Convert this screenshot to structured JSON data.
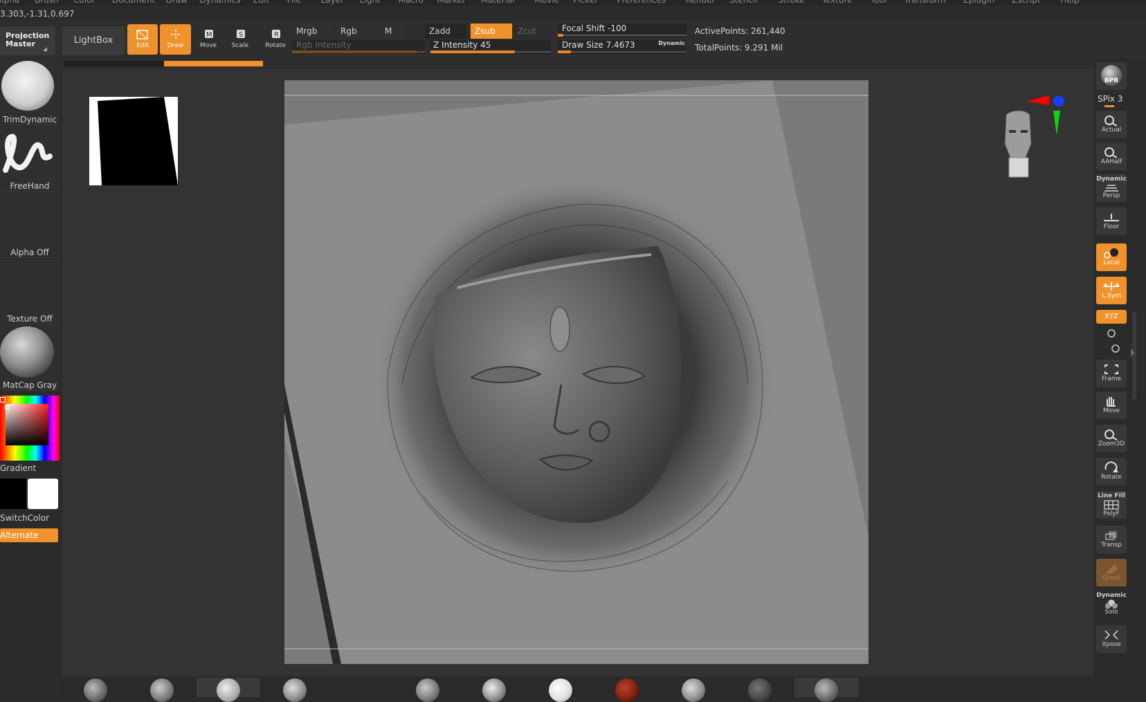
{
  "menu": [
    "Alpha",
    "Brush",
    "Color",
    "Document",
    "Draw",
    "Dynamics",
    "Edit",
    "File",
    "Layer",
    "Light",
    "Macro",
    "Marker",
    "Material",
    "Movie",
    "Picker",
    "Preferences",
    "Render",
    "Stencil",
    "Stroke",
    "Texture",
    "Tool",
    "Transform",
    "Zplugin",
    "Zscript",
    "Help"
  ],
  "coords": "3.303,-1.31,0.697",
  "toolbar": {
    "projection_master": "Projection Master",
    "lightbox": "LightBox",
    "edit": "Edit",
    "draw": "Draw",
    "move": "Move",
    "scale": "Scale",
    "rotate": "Rotate",
    "mrgb": "Mrgb",
    "rgb": "Rgb",
    "m": "M",
    "rgb_intensity": "Rgb Intensity",
    "zadd": "Zadd",
    "zsub": "Zsub",
    "zcut": "Zcut",
    "z_intensity": "Z Intensity 45",
    "focal_shift": "Focal Shift -100",
    "draw_size": "Draw Size 7.4673",
    "dynamic": "Dynamic",
    "active_points": "ActivePoints: 261,440",
    "total_points": "TotalPoints: 9.291 Mil"
  },
  "slider_levels": {
    "rgb_intensity": 0.94,
    "z_intensity": 0.7,
    "focal_shift": 0.02,
    "draw_size": 0.1
  },
  "left_tray": {
    "brush": "TrimDynamic",
    "stroke": "FreeHand",
    "alpha": "Alpha Off",
    "texture": "Texture Off",
    "material": "MatCap Gray",
    "gradient": "Gradient",
    "switch_color": "SwitchColor",
    "alternate": "Alternate"
  },
  "right_tray": {
    "bpr": "BPR",
    "spix": "SPix 3",
    "actual": "Actual",
    "aahalf": "AAHalf",
    "persp_top": "Dynamic",
    "persp": "Persp",
    "floor": "Floor",
    "local": "Local",
    "lsym": "L.Sym",
    "xyz": "XYZ",
    "frame": "Frame",
    "move": "Move",
    "zoom3d": "Zoom3D",
    "rotate": "Rotate",
    "polyf_top": "Line Fill",
    "polyf": "PolyF",
    "transp": "Transp",
    "ghost": "Ghost",
    "solo_top": "Dynamic",
    "solo": "Solo",
    "xpose": "Xpose"
  },
  "colors": {
    "accent": "#f0922b",
    "ui_bg": "#2b2b2b",
    "viewport_bg": "#848484"
  }
}
